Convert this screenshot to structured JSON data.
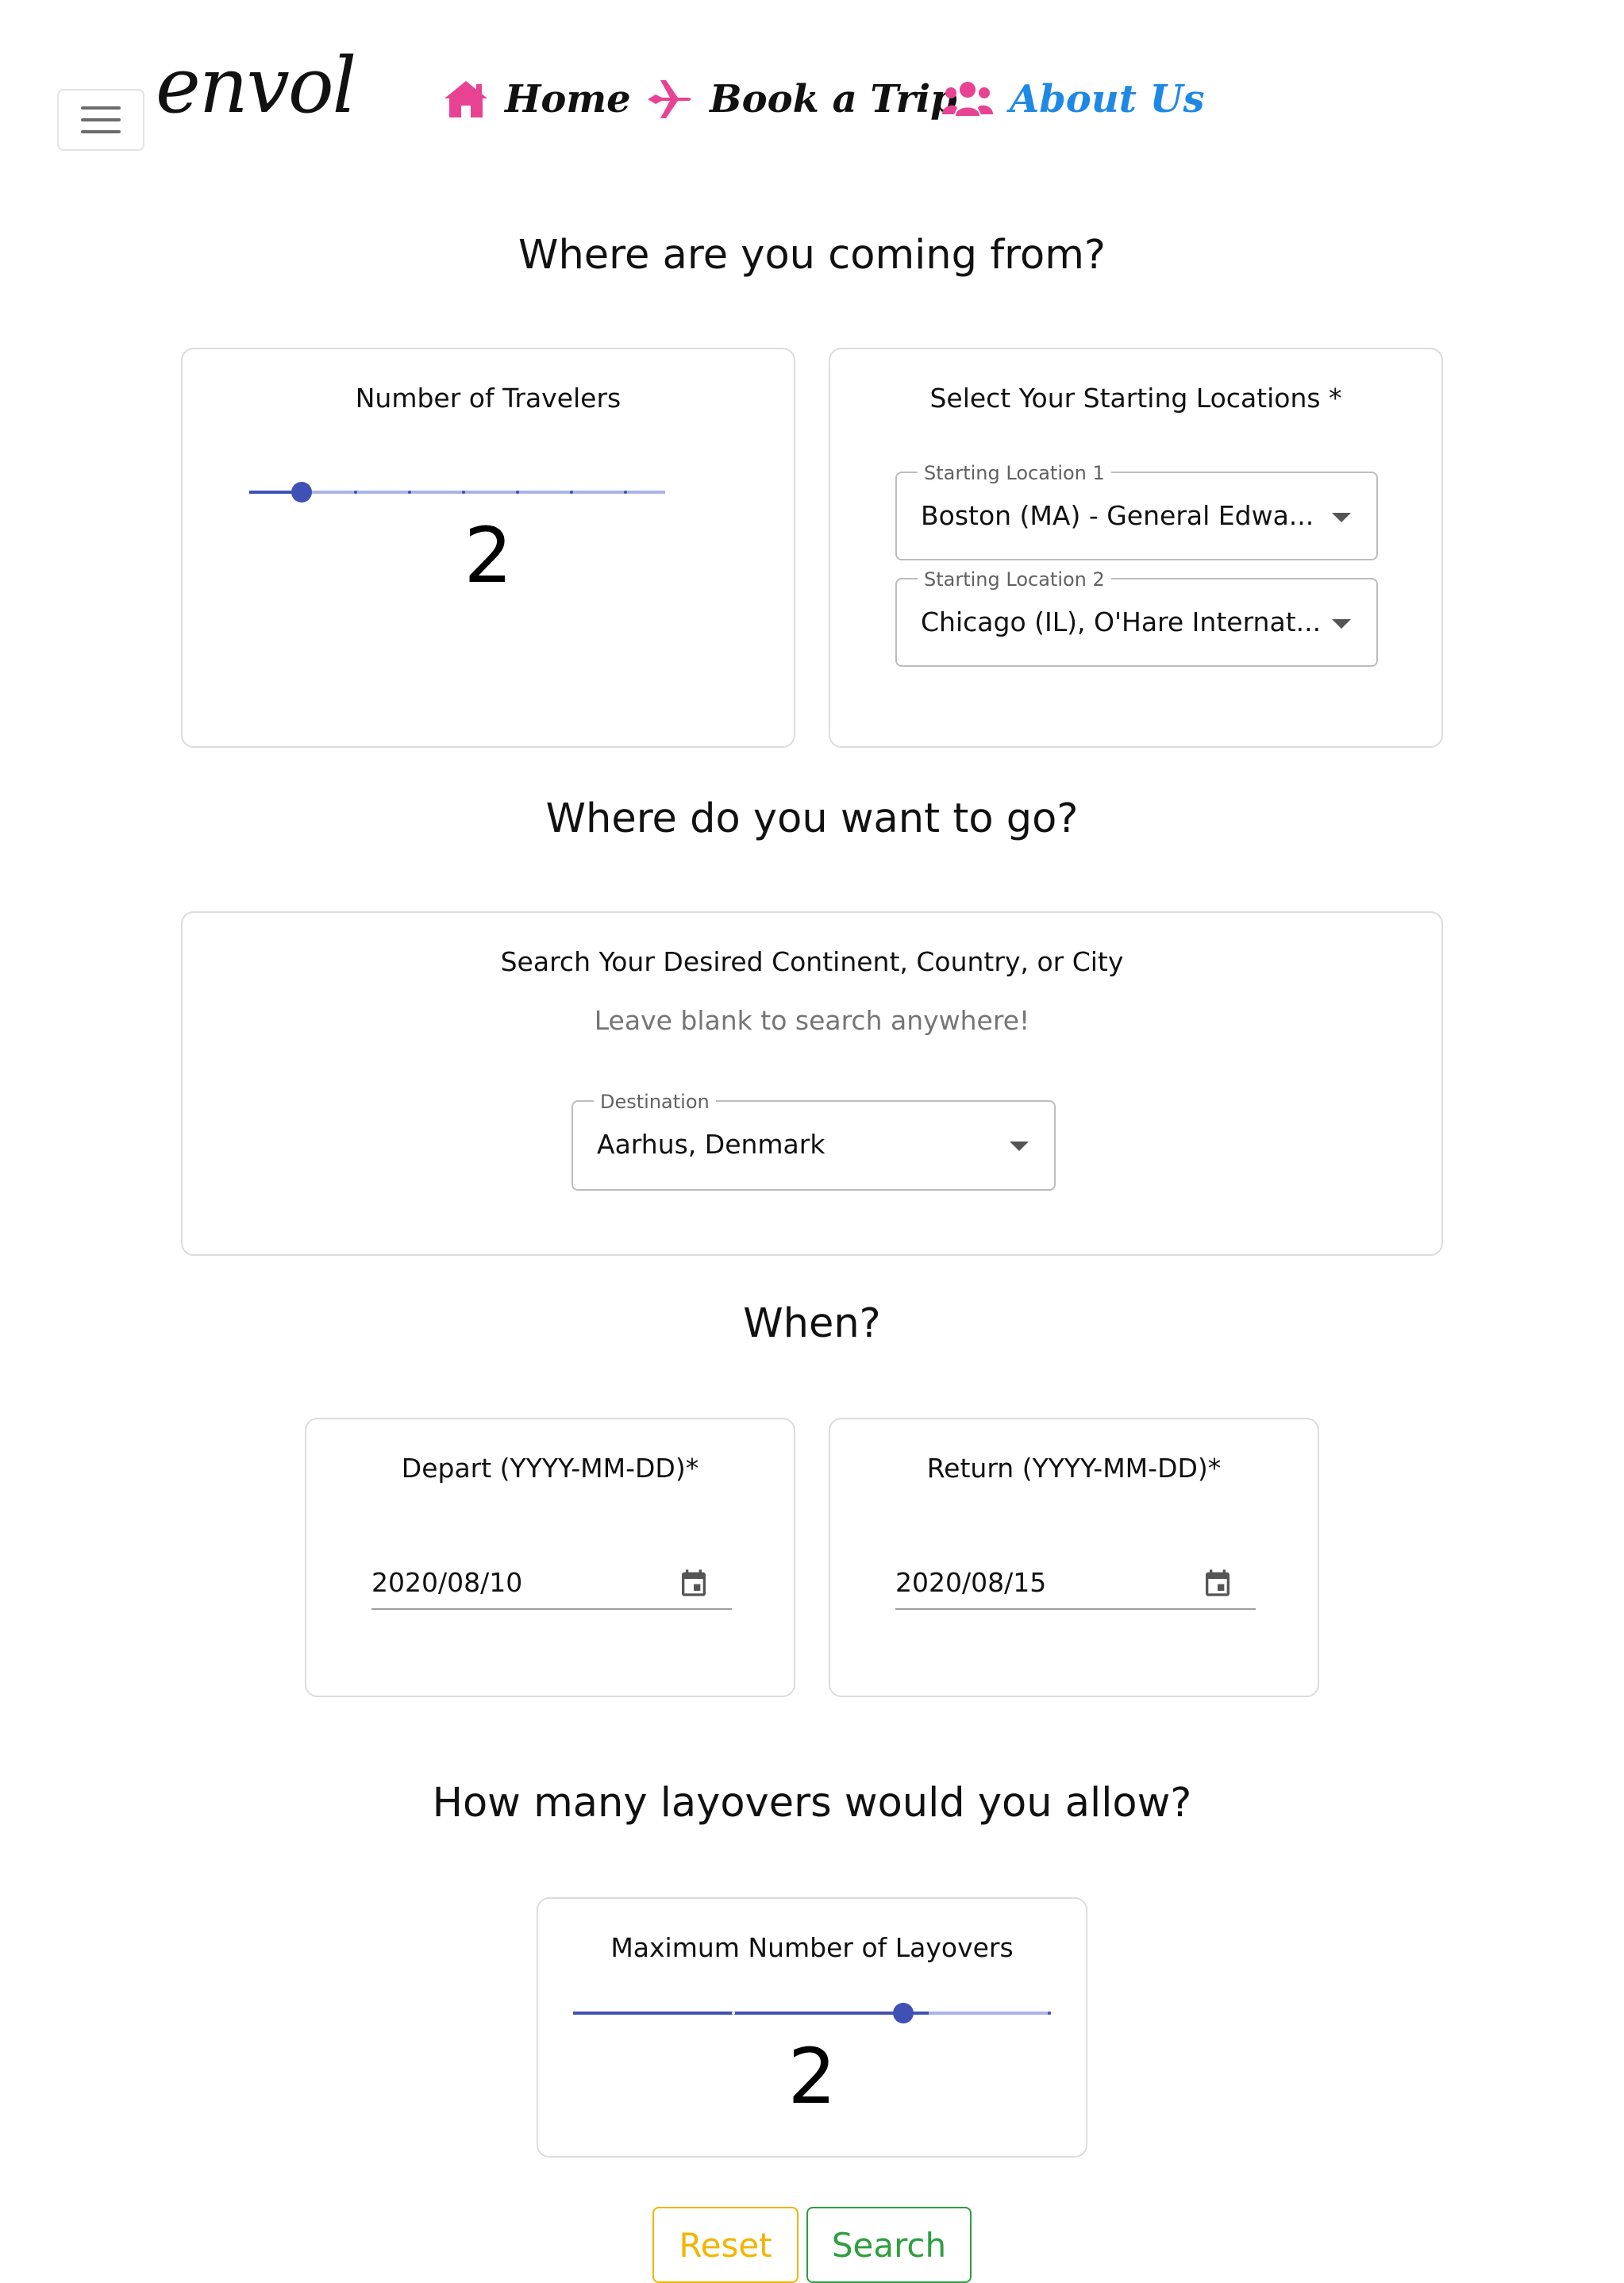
{
  "navbar": {
    "brand": "envol",
    "items": [
      {
        "label": "Home",
        "icon": "home-icon",
        "color": "#111111",
        "icon_color": "#e84393"
      },
      {
        "label": "Book a Trip",
        "icon": "plane-icon",
        "color": "#111111",
        "icon_color": "#e84393"
      },
      {
        "label": "About Us",
        "icon": "users-icon",
        "color": "#1e88e5",
        "icon_color": "#e84393"
      }
    ]
  },
  "origin": {
    "heading": "Where are you coming from?",
    "travelers": {
      "title": "Number of Travelers",
      "value": "2",
      "min": 1,
      "max": 10,
      "slider_value": 2
    },
    "locations": {
      "title": "Select Your Starting Locations *",
      "fields": [
        {
          "label": "Starting Location 1",
          "value": "Boston (MA) - General Edwa..."
        },
        {
          "label": "Starting Location 2",
          "value": "Chicago (IL), O'Hare Internat..."
        }
      ]
    }
  },
  "destination": {
    "heading": "Where do you want to go?",
    "title": "Search Your Desired Continent, Country, or City",
    "hint": "Leave blank to search anywhere!",
    "field_label": "Destination",
    "field_value": "Aarhus, Denmark"
  },
  "dates": {
    "heading": "When?",
    "depart": {
      "title": "Depart (YYYY-MM-DD)*",
      "value": "2020/08/10"
    },
    "return": {
      "title": "Return (YYYY-MM-DD)*",
      "value": "2020/08/15"
    }
  },
  "layovers": {
    "heading": "How many layovers would you allow?",
    "title": "Maximum Number of Layovers",
    "value": "2",
    "min": 0,
    "max": 3,
    "slider_value": 2
  },
  "actions": {
    "reset_label": "Reset",
    "search_label": "Search",
    "reset_color": "#f4b400",
    "search_color": "#2e9e3e"
  },
  "colors": {
    "accent": "#3f51b5",
    "accent_light": "#aab4e8"
  }
}
